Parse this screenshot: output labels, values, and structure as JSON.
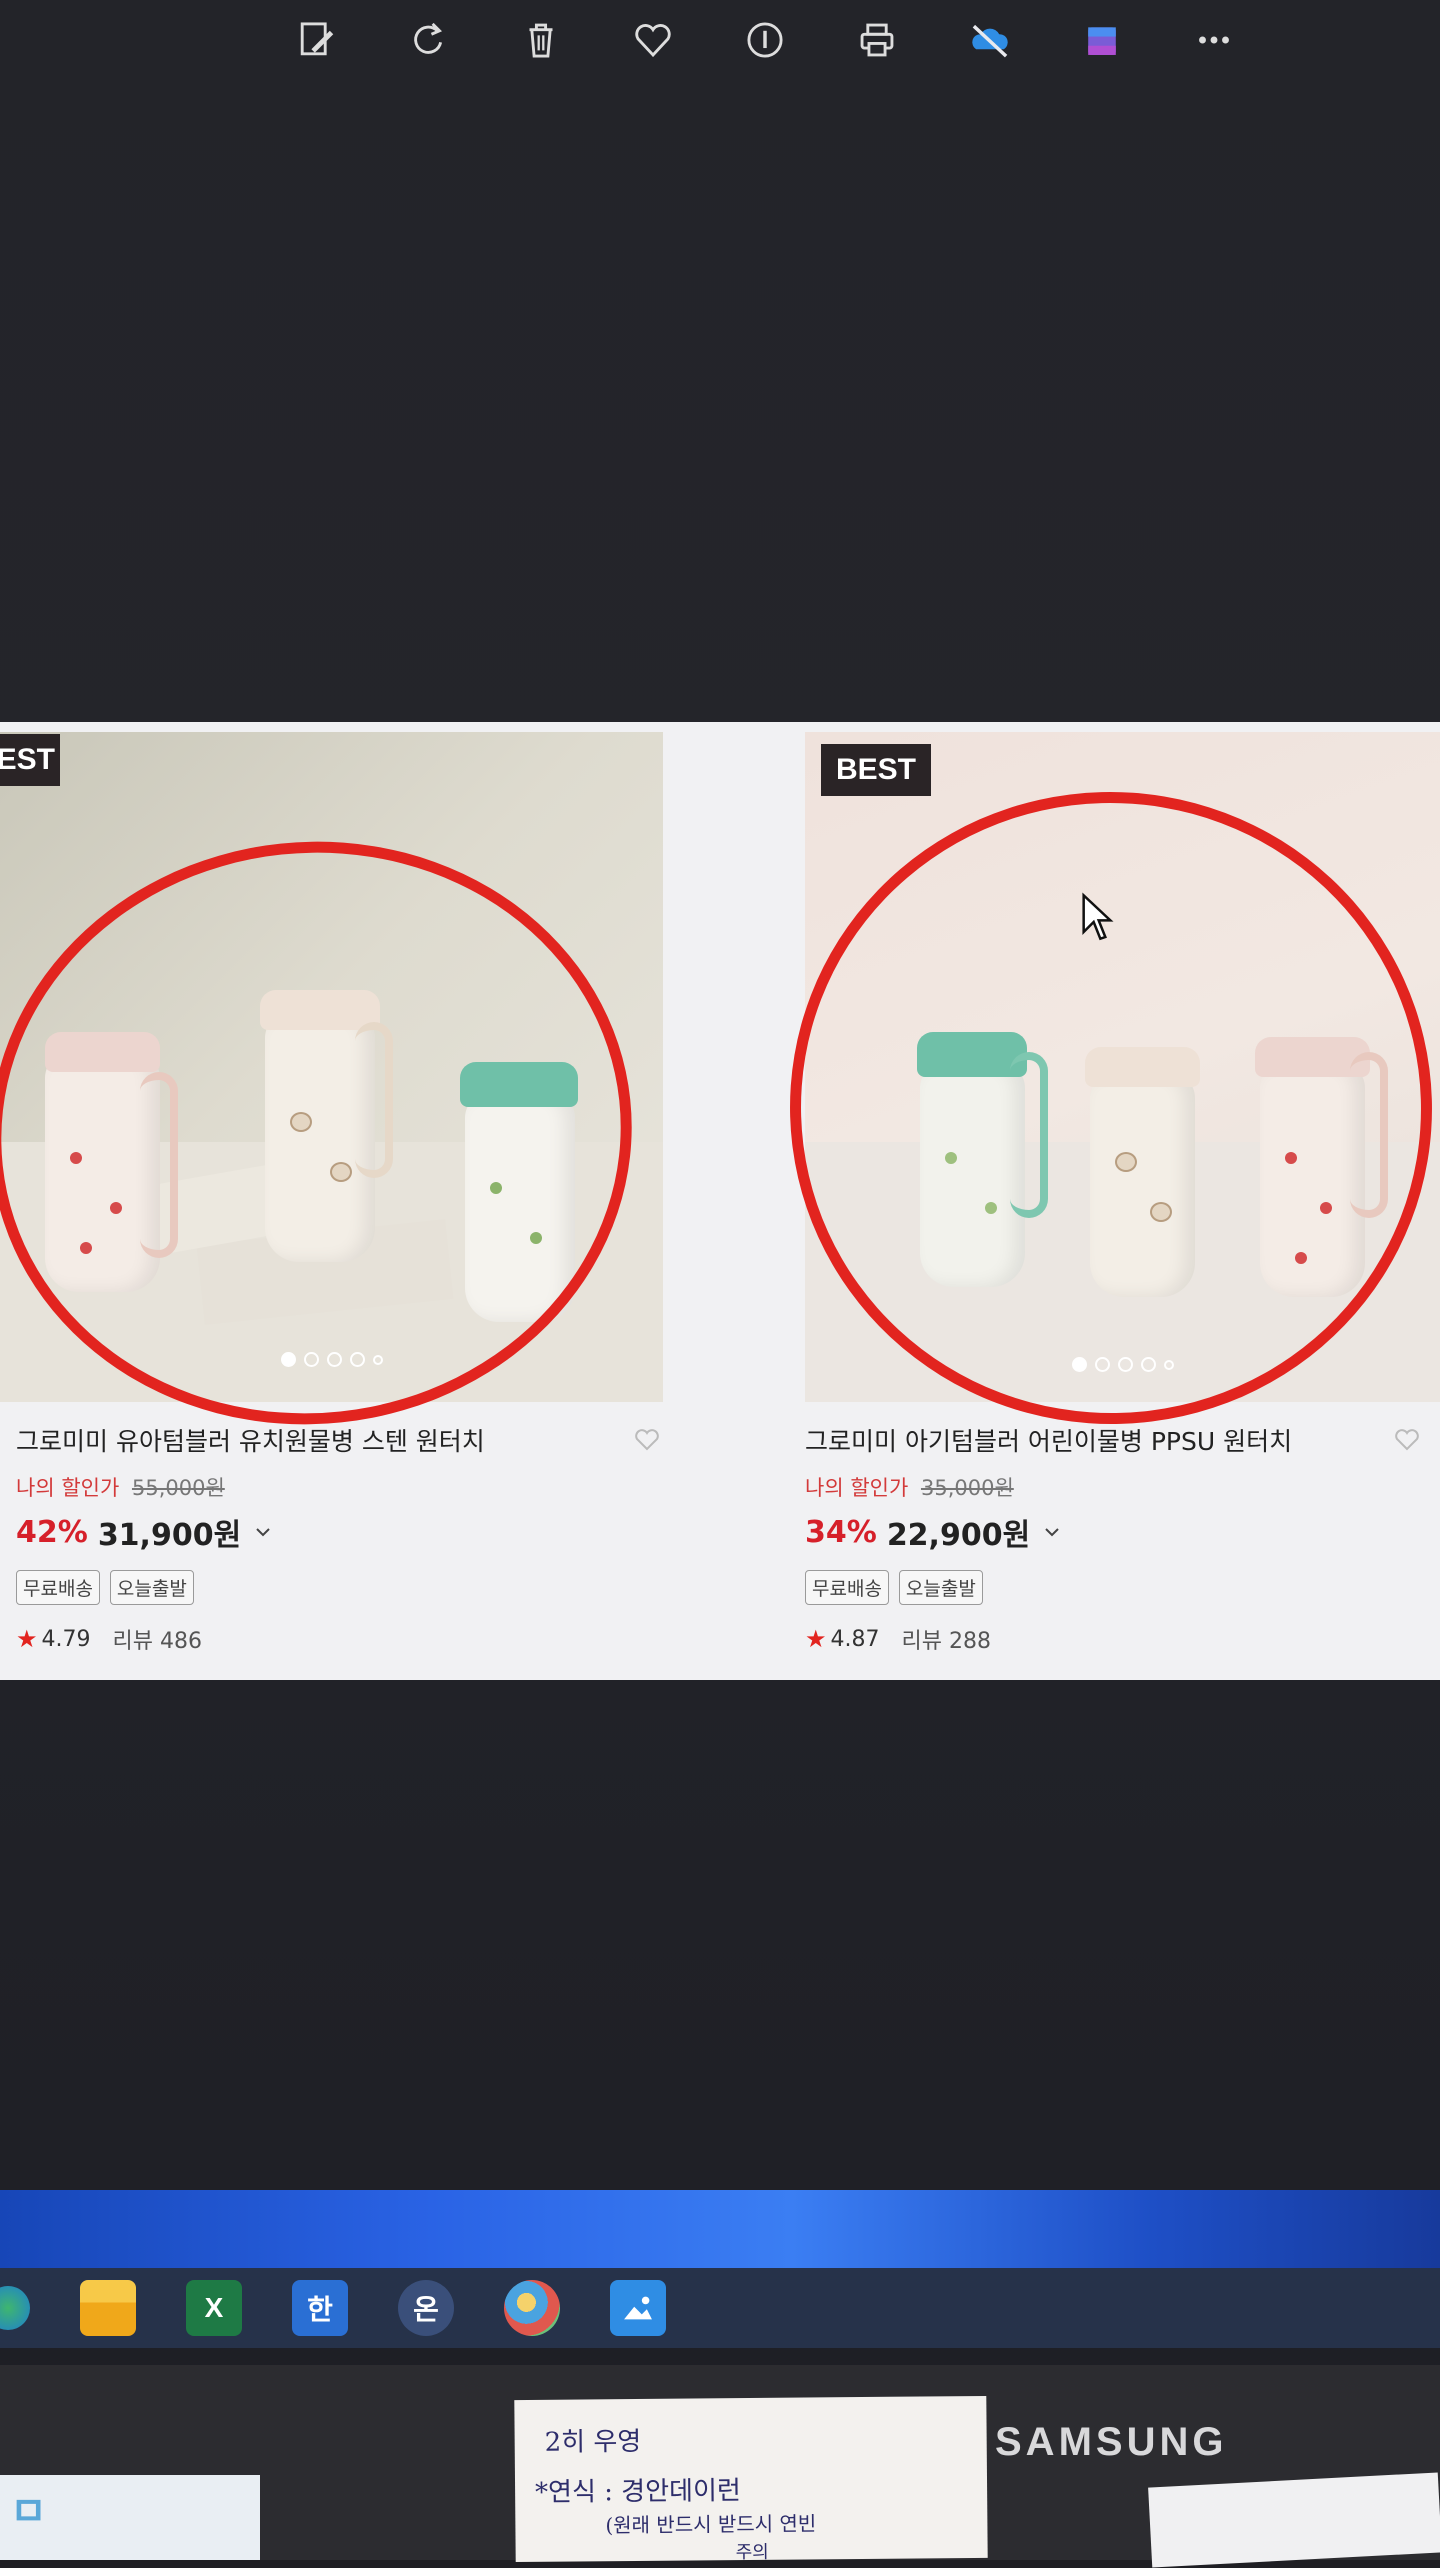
{
  "viewer_toolbar": {
    "icons": [
      "edit-icon",
      "rotate-icon",
      "trash-icon",
      "heart-icon",
      "info-icon",
      "print-icon",
      "onedrive-icon",
      "clipchamp-icon",
      "more-icon"
    ],
    "more_label": "..."
  },
  "products": [
    {
      "badge": "BEST",
      "title": "그로미미 유아텀블러 유치원물병 스텐 원터치",
      "discount_label": "나의 할인가",
      "original_price": "55,000원",
      "discount_percent": "42%",
      "price": "31,900원",
      "tags": [
        "무료배송",
        "오늘출발"
      ],
      "rating": "4.79",
      "review_label": "리뷰 486"
    },
    {
      "badge": "BEST",
      "title": "그로미미 아기텀블러 어린이물병 PPSU 원터치",
      "discount_label": "나의 할인가",
      "original_price": "35,000원",
      "discount_percent": "34%",
      "price": "22,900원",
      "tags": [
        "무료배송",
        "오늘출발"
      ],
      "rating": "4.87",
      "review_label": "리뷰 288"
    }
  ],
  "taskbar": {
    "apps": [
      {
        "icon": "edge-icon",
        "label": ""
      },
      {
        "icon": "file-explorer-icon",
        "label": ""
      },
      {
        "icon": "excel-icon",
        "label": "X"
      },
      {
        "icon": "hangul-icon",
        "label": "한"
      },
      {
        "icon": "on-icon",
        "label": "온"
      },
      {
        "icon": "paint-icon",
        "label": ""
      },
      {
        "icon": "photos-icon",
        "label": ""
      }
    ]
  },
  "monitor": {
    "brand": "SAMSUNG"
  },
  "colors": {
    "accent_red": "#e2241f",
    "discount_red": "#d6202a",
    "badge_bg": "#2a2426"
  }
}
